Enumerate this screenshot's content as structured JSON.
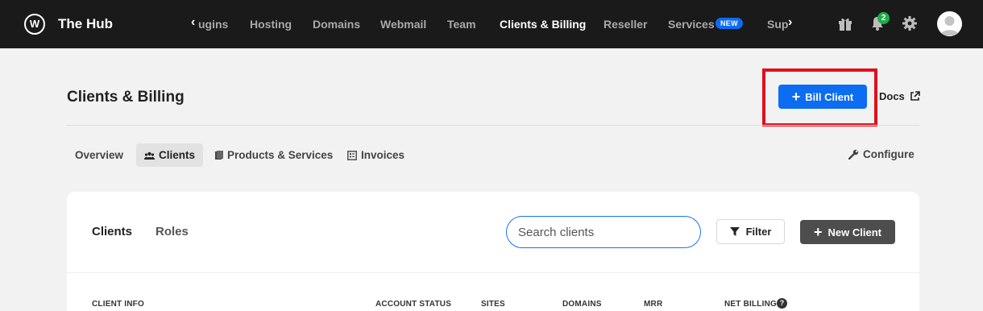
{
  "topbar": {
    "brand": "The Hub",
    "logo_glyph": "W",
    "nav_prev": "‹",
    "nav_next": "›",
    "nav_items": [
      "ugins",
      "Hosting",
      "Domains",
      "Webmail",
      "Team",
      "Clients & Billing",
      "Reseller",
      "Services",
      "Sup"
    ],
    "new_badge": "NEW",
    "notification_count": "2",
    "icons": [
      "gift-icon",
      "bell-icon",
      "gear-icon",
      "avatar"
    ]
  },
  "page": {
    "title": "Clients & Billing",
    "bill_client_label": "Bill Client",
    "docs_label": "Docs"
  },
  "subtabs": [
    {
      "label": "Overview",
      "icon": ""
    },
    {
      "label": "Clients",
      "icon": "users-icon"
    },
    {
      "label": "Products & Services",
      "icon": "book-icon"
    },
    {
      "label": "Invoices",
      "icon": "invoice-icon"
    }
  ],
  "configure_label": "Configure",
  "card": {
    "tabs": [
      "Clients",
      "Roles"
    ],
    "search_placeholder": "Search clients",
    "filter_label": "Filter",
    "new_client_label": "New Client",
    "columns": [
      "CLIENT INFO",
      "ACCOUNT STATUS",
      "SITES",
      "DOMAINS",
      "MRR",
      "NET BILLING"
    ]
  },
  "colors": {
    "primary": "#0c6cf2",
    "highlight": "#e10f1a",
    "topbar": "#1a1a1a",
    "notification": "#1fae4a"
  }
}
